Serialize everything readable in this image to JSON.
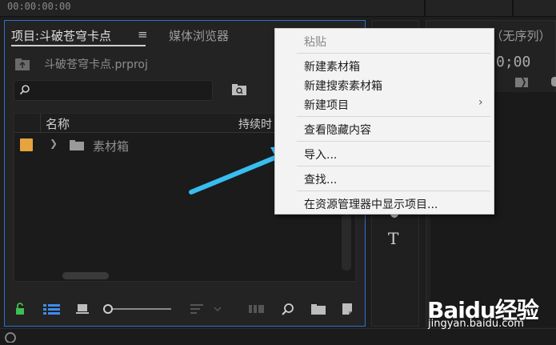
{
  "timecode": "00:00:00:00",
  "project_panel": {
    "tab_project_label": "项目:斗破苍穹卡点",
    "tab_menu_glyph": "≡",
    "tab_media_label": "媒体浏览器",
    "file_name": "斗破苍穹卡点.prproj",
    "search_placeholder": "",
    "columns": {
      "name": "名称",
      "duration": "持续时"
    },
    "items": [
      {
        "label": "素材箱",
        "color": "#e7a33e"
      }
    ]
  },
  "right_panel": {
    "title": "节目：（无序列）",
    "timecode": "0;00"
  },
  "tools_panel": {
    "type_tool_glyph": "T"
  },
  "context_menu": {
    "items": [
      {
        "label": "粘贴",
        "disabled": true
      },
      {
        "label": "新建素材箱"
      },
      {
        "label": "新建搜索素材箱"
      },
      {
        "label": "新建项目",
        "has_submenu": true,
        "submenu_glyph": "›"
      },
      {
        "label": "查看隐藏内容"
      },
      {
        "label": "导入..."
      },
      {
        "label": "查找..."
      },
      {
        "label": "在资源管理器中显示项目..."
      }
    ]
  },
  "icons": [
    "search-icon",
    "new-bin-icon",
    "folder-icon",
    "lock-icon",
    "list-view-icon",
    "icon-view-icon",
    "zoom-slider",
    "sort-icon",
    "automate-icon",
    "find-icon",
    "new-item-icon",
    "chevron-right-icon",
    "type-tool-icon",
    "creative-cloud-icon"
  ],
  "colors": {
    "accent_border": "#2f6fd0",
    "bin_color": "#e7a33e",
    "lock_green": "#3ebf54",
    "active_blue": "#3d8cf0",
    "arrow_annotation": "#38bdf0"
  },
  "watermark": {
    "logo_text": "Baidu经验",
    "url": "jingyan.baidu.com"
  }
}
